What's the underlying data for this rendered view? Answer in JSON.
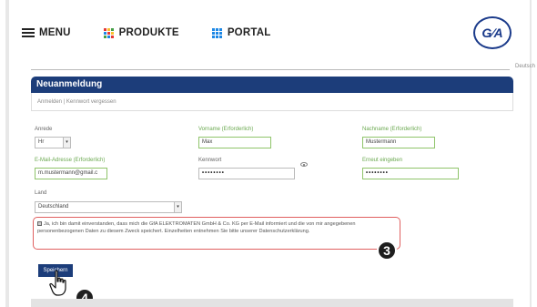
{
  "nav": {
    "menu": "MENU",
    "products": "PRODUKTE",
    "portal": "PORTAL"
  },
  "logo": {
    "text": "G∕A"
  },
  "language": "Deutsch",
  "panel": {
    "title": "Neuanmeldung",
    "tabs": "Anmelden | Kennwort vergessen"
  },
  "form": {
    "salutation": {
      "label": "Anrede",
      "value": "Hr"
    },
    "first_name": {
      "label": "Vorname (Erforderlich)",
      "value": "Max"
    },
    "last_name": {
      "label": "Nachname (Erforderlich)",
      "value": "Mustermann"
    },
    "email": {
      "label": "E-Mail-Adresse (Erforderlich)",
      "value": "m.mustermann@gmail.c"
    },
    "password": {
      "label": "Kennwort",
      "value": "••••••••"
    },
    "password_repeat": {
      "label": "Erneut eingeben",
      "value": "••••••••"
    },
    "country": {
      "label": "Land",
      "value": "Deutschland"
    },
    "consent_text": "Ja, ich bin damit einverstanden, dass mich die GfA ELEKTROMATEN GmbH & Co. KG per E-Mail informiert und die von mir angegebenen personenbezogenen Daten zu diesem Zweck speichert. Einzelheiten entnehmen Sie bitte unserer Datenschutzerklärung.",
    "save_label": "Speichern"
  },
  "steps": {
    "three": "3",
    "four": "4"
  },
  "colors": {
    "brand_blue": "#1c3d7a",
    "valid_green": "#8fc46a",
    "highlight_red": "#e06060"
  },
  "icons": [
    "hamburger-icon",
    "grid-icon",
    "eye-icon",
    "hand-cursor-icon"
  ]
}
